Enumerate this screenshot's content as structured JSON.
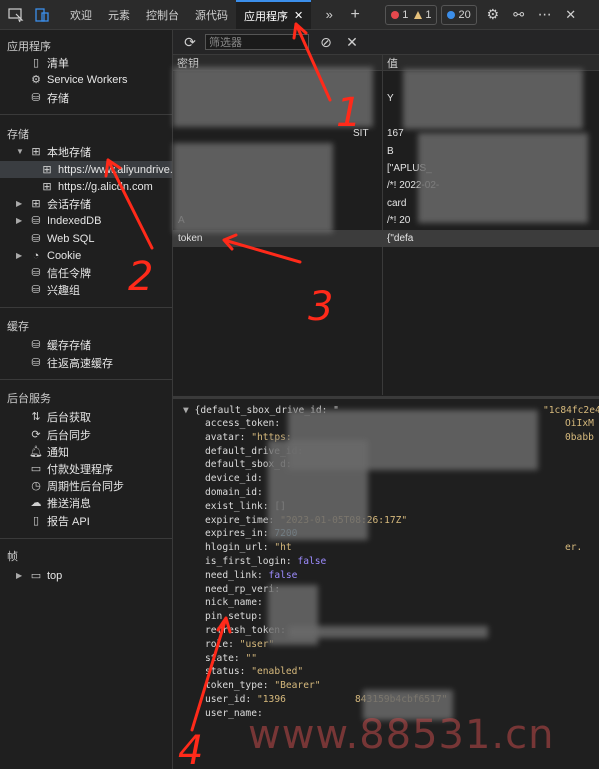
{
  "tabs": [
    {
      "label": "欢迎"
    },
    {
      "label": "元素"
    },
    {
      "label": "控制台"
    },
    {
      "label": "源代码"
    },
    {
      "label": "应用程序"
    }
  ],
  "badges": {
    "errors": "1",
    "warnings": "1",
    "info": "20"
  },
  "colors": {
    "accent": "#3b8eea",
    "error": "#e5484d",
    "warning": "#e5c07b",
    "info": "#3b8eea",
    "annotation": "#ff2a1a"
  },
  "sidebar": {
    "app_section": "应用程序",
    "app_items": [
      "清单",
      "Service Workers",
      "存储"
    ],
    "storage_section": "存储",
    "local_storage": "本地存储",
    "local_children": [
      "https://www.aliyundrive.c",
      "https://g.alicdn.com"
    ],
    "storage_items": [
      "会话存储",
      "IndexedDB",
      "Web SQL",
      "Cookie",
      "信任令牌",
      "兴趣组"
    ],
    "cache_section": "缓存",
    "cache_items": [
      "缓存存储",
      "往返高速缓存"
    ],
    "bg_section": "后台服务",
    "bg_items": [
      "后台获取",
      "后台同步",
      "通知",
      "付款处理程序",
      "周期性后台同步",
      "推送消息",
      "报告 API"
    ],
    "frames_section": "帧",
    "frames_items": [
      "top"
    ]
  },
  "toolbar": {
    "filter_placeholder": "筛选器"
  },
  "table": {
    "headers": [
      "密钥",
      "值"
    ],
    "rows": [
      {
        "key": "",
        "value": ""
      },
      {
        "key": "",
        "value": "Y"
      },
      {
        "key": "",
        "value": ""
      },
      {
        "key": "SIT",
        "value": "167"
      },
      {
        "key": "",
        "value": "B"
      },
      {
        "key": "",
        "value": "[\"APLUS_"
      },
      {
        "key": "",
        "value": "/*! 2022-02-"
      },
      {
        "key": "",
        "value": "card"
      },
      {
        "key": "A",
        "value": "/*! 20"
      },
      {
        "key": "token",
        "value": "{\"defa"
      }
    ]
  },
  "json": {
    "root": "{default_sbox_drive_id: \"",
    "root_tail": "\"1c84fc2e4",
    "entries": [
      {
        "k": "access_token",
        "v": "",
        "type": "str",
        "tail": "OiIxM"
      },
      {
        "k": "avatar",
        "v": "\"https:",
        "type": "str",
        "tail": "0babb"
      },
      {
        "k": "default_drive_id",
        "v": "",
        "type": "str"
      },
      {
        "k": "default_sbox_d",
        "v": "",
        "type": "str"
      },
      {
        "k": "device_id",
        "v": "",
        "type": "str"
      },
      {
        "k": "domain_id",
        "v": "",
        "type": "str"
      },
      {
        "k": "exist_link",
        "v": "[]",
        "type": "plain"
      },
      {
        "k": "expire_time",
        "v": "\"2023-01-05T08:26:17Z\"",
        "type": "str"
      },
      {
        "k": "expires_in",
        "v": "7200",
        "type": "num"
      },
      {
        "k": "hlogin_url",
        "v": "\"ht",
        "type": "str",
        "tail": "er."
      },
      {
        "k": "is_first_login",
        "v": "false",
        "type": "bool"
      },
      {
        "k": "need_link",
        "v": "false",
        "type": "bool"
      },
      {
        "k": "need_rp_veri",
        "v": "",
        "type": "bool"
      },
      {
        "k": "nick_name",
        "v": "",
        "type": "str"
      },
      {
        "k": "pin_setup",
        "v": "",
        "type": "bool"
      },
      {
        "k": "refresh_token",
        "v": "",
        "type": "str"
      },
      {
        "k": "role",
        "v": "\"user\"",
        "type": "str"
      },
      {
        "k": "state",
        "v": "\"\"",
        "type": "str"
      },
      {
        "k": "status",
        "v": "\"enabled\"",
        "type": "str"
      },
      {
        "k": "token_type",
        "v": "\"Bearer\"",
        "type": "str"
      },
      {
        "k": "user_id",
        "v": "\"1396",
        "type": "str",
        "tail": "843159b4cbf6517\""
      },
      {
        "k": "user_name",
        "v": "",
        "type": "str"
      }
    ]
  },
  "annotations": [
    "1",
    "2",
    "3",
    "4"
  ],
  "watermark": "www.88531.cn"
}
